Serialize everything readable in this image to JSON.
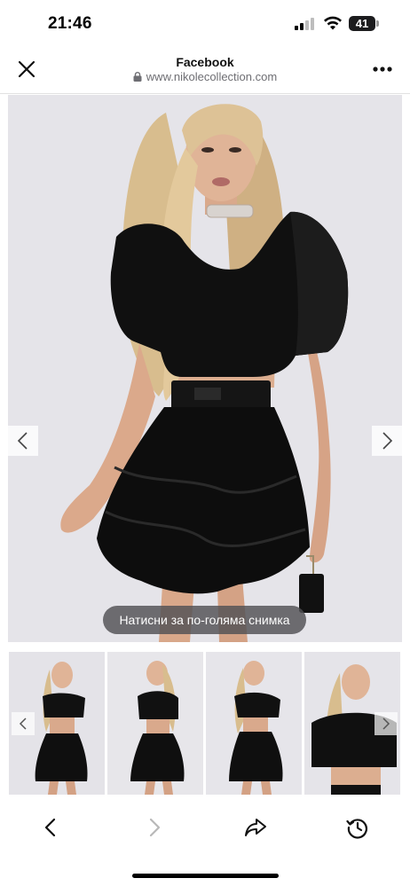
{
  "status_bar": {
    "time": "21:46",
    "battery": "41",
    "signal_icon": "cellular-signal-icon",
    "wifi_icon": "wifi-icon"
  },
  "browser_header": {
    "title": "Facebook",
    "url": "www.nikolecollection.com",
    "close_icon": "close-icon",
    "lock_icon": "lock-icon",
    "more_icon": "more-dots-icon"
  },
  "gallery": {
    "enlarge_label": "Натисни за по-голяма снимка",
    "prev_icon": "chevron-left-icon",
    "next_icon": "chevron-right-icon",
    "thumbnail_count": 4
  },
  "toolbar": {
    "back_icon": "back-arrow-icon",
    "forward_icon": "forward-arrow-icon",
    "share_icon": "share-icon",
    "history_icon": "history-icon"
  },
  "colors": {
    "background": "#ffffff",
    "text": "#111111",
    "url_gray": "#6e6e73",
    "pill_bg": "#505054",
    "outfit_black": "#0d0d0d",
    "hair_blonde": "#d8bd8e"
  }
}
